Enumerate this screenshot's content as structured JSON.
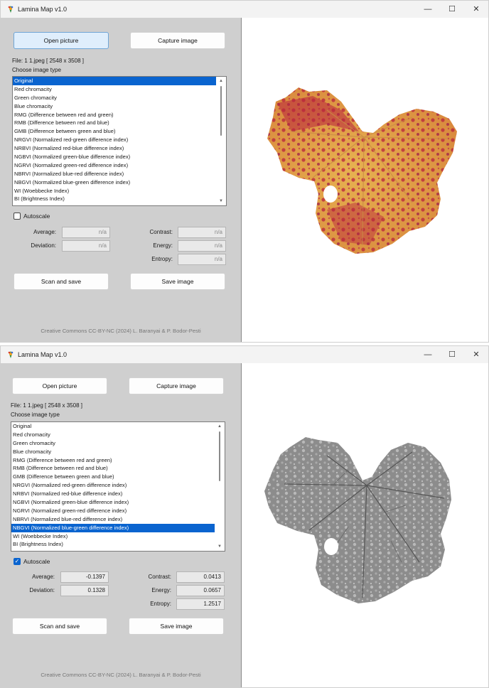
{
  "app": {
    "title": "Lamina Map v1.0"
  },
  "titlebar": {
    "minimize": "—",
    "maximize": "☐",
    "close": "✕"
  },
  "buttons": {
    "open": "Open picture",
    "capture": "Capture image",
    "scan": "Scan and save",
    "save": "Save image"
  },
  "file_info": "File: 1 1.jpeg [ 2548 x 3508 ]",
  "choose_label": "Choose image type",
  "image_types": [
    "Original",
    "Red chromacity",
    "Green chromacity",
    "Blue chromacity",
    "RMG (Difference between red and green)",
    "RMB (Difference between red and blue)",
    "GMB (Difference between green and blue)",
    "NRGVI (Normalized red-green difference index)",
    "NRBVI (Normalized red-blue difference index)",
    "NGBVI (Normalized green-blue difference index)",
    "NGRVI (Normalized green-red difference index)",
    "NBRVI (Normalized blue-red difference index)",
    "NBGVI (Normalized blue-green difference index)",
    "WI (Woebbecke Index)",
    "BI (Brightness Index)"
  ],
  "stat_labels": {
    "average": "Average:",
    "deviation": "Deviation:",
    "contrast": "Contrast:",
    "energy": "Energy:",
    "entropy": "Entropy:"
  },
  "autoscale_label": "Autoscale",
  "footer": "Creative Commons CC-BY-NC (2024) L. Baranyai & P. Bodor-Pesti",
  "window1": {
    "selected_index": 0,
    "autoscale_checked": false,
    "stats": {
      "average": "n/a",
      "deviation": "n/a",
      "contrast": "n/a",
      "energy": "n/a",
      "entropy": "n/a"
    }
  },
  "window2": {
    "selected_index": 12,
    "autoscale_checked": true,
    "stats": {
      "average": "-0.1397",
      "deviation": "0.1328",
      "contrast": "0.0413",
      "energy": "0.0657",
      "entropy": "1.2517"
    }
  },
  "colors": {
    "selection": "#0a64cf",
    "panel": "#cfcfcf",
    "leaf_red": "#b8233c",
    "leaf_yellow": "#e1a64a",
    "leaf_gray": "#8c8c8c"
  }
}
